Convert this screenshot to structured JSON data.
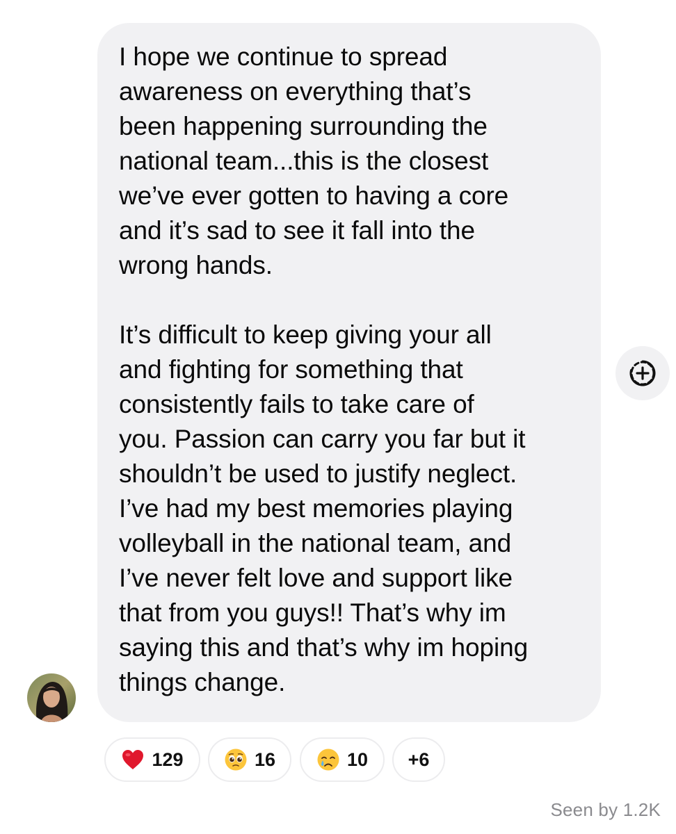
{
  "message": {
    "paragraphs": [
      "I hope we continue to spread\nawareness on everything that’s\nbeen happening surrounding the\nnational team...this is the closest\nwe’ve ever gotten to having a core\nand it’s sad to see it fall into the\nwrong hands.",
      "It’s difficult to keep giving your all\nand fighting for something that\nconsistently fails to take care of\nyou. Passion can carry you far but it\nshouldn’t be used to justify neglect.\nI’ve had my best memories playing\nvolleyball in the national team, and\nI’ve never felt love and support like\nthat from you guys!! That’s why im\nsaying this and that’s why im hoping\nthings change."
    ]
  },
  "react_button": {
    "icon": "add-reaction-icon"
  },
  "sender": {
    "avatar_icon": "profile-photo"
  },
  "reactions": [
    {
      "icon": "red-heart-emoji",
      "count": "129"
    },
    {
      "icon": "pleading-face-emoji",
      "count": "16"
    },
    {
      "icon": "crying-face-emoji",
      "count": "10"
    },
    {
      "icon": "",
      "count": "+6"
    }
  ],
  "seen_label": "Seen by 1.2K",
  "colors": {
    "bubble_background": "#f1f1f3",
    "text": "#0a0a0a",
    "muted_text": "#8a8a8e",
    "pill_border": "#ececee"
  }
}
